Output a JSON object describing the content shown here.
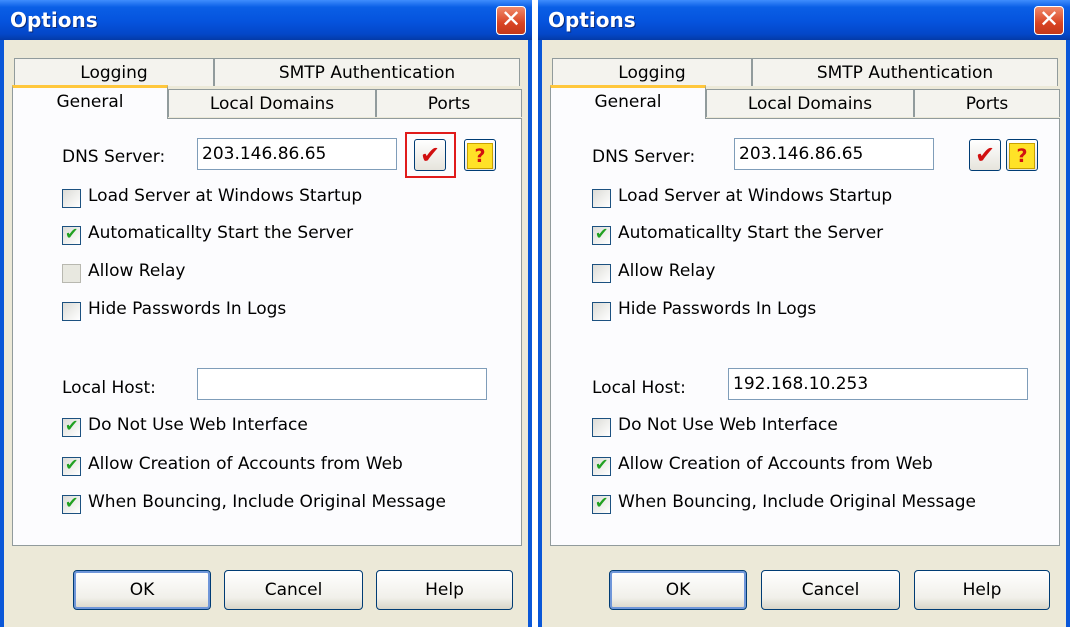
{
  "dialogs": [
    {
      "title": "Options",
      "tabs": {
        "logging": "Logging",
        "smtp_auth": "SMTP Authentication",
        "general": "General",
        "local_domains": "Local Domains",
        "ports": "Ports"
      },
      "dns_label": "DNS Server:",
      "dns_value": "203.146.86.65",
      "checkbox_labels": [
        "Load Server at Windows Startup",
        "Automaticallty Start the Server",
        "Allow Relay",
        "Hide Passwords In Logs"
      ],
      "local_host_label": "Local Host:",
      "local_host_value": "",
      "checkbox_labels_2": [
        "Do Not Use Web Interface",
        "Allow Creation of Accounts from Web",
        "When Bouncing, Include Original Message"
      ],
      "checked": [
        false,
        true,
        false,
        false
      ],
      "checked_2": [
        true,
        true,
        true
      ],
      "buttons": {
        "ok": "OK",
        "cancel": "Cancel",
        "help": "Help"
      },
      "highlight_check_button": true
    },
    {
      "title": "Options",
      "tabs": {
        "logging": "Logging",
        "smtp_auth": "SMTP Authentication",
        "general": "General",
        "local_domains": "Local Domains",
        "ports": "Ports"
      },
      "dns_label": "DNS Server:",
      "dns_value": "203.146.86.65",
      "checkbox_labels": [
        "Load Server at Windows Startup",
        "Automaticallty Start the Server",
        "Allow Relay",
        "Hide Passwords In Logs"
      ],
      "local_host_label": "Local Host:",
      "local_host_value": "192.168.10.253",
      "checkbox_labels_2": [
        "Do Not Use Web Interface",
        "Allow Creation of Accounts from Web",
        "When Bouncing, Include Original Message"
      ],
      "checked": [
        false,
        true,
        false,
        false
      ],
      "checked_2": [
        false,
        true,
        true
      ],
      "buttons": {
        "ok": "OK",
        "cancel": "Cancel",
        "help": "Help"
      },
      "highlight_check_button": false
    }
  ],
  "colors": {
    "title_bar": "#0553dd",
    "close_button": "#d94423",
    "highlight": "#e01b1b",
    "check_tick": "#21a121"
  },
  "icons": {
    "check_button": "red-checkmark-icon",
    "help_button": "question-mark-icon",
    "close": "close-icon"
  }
}
